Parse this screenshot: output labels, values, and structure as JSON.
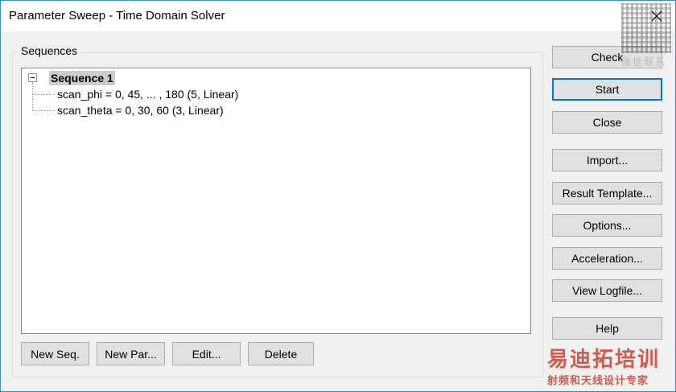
{
  "window": {
    "title": "Parameter Sweep - Time Domain Solver"
  },
  "group": {
    "label": "Sequences"
  },
  "tree": {
    "root": "Sequence 1",
    "items": [
      "scan_phi = 0, 45, ... , 180 (5, Linear)",
      "scan_theta = 0, 30, 60 (3, Linear)"
    ]
  },
  "side_buttons": {
    "check": "Check",
    "start": "Start",
    "close": "Close",
    "import": "Import...",
    "result_template": "Result Template...",
    "options": "Options...",
    "acceleration": "Acceleration...",
    "view_logfile": "View Logfile...",
    "help": "Help"
  },
  "bottom_buttons": {
    "new_seq": "New Seq.",
    "new_par": "New Par...",
    "edit": "Edit...",
    "delete": "Delete"
  },
  "watermark": {
    "qr_label": "微信联系",
    "brand": "易迪拓培训",
    "tagline": "射频和天线设计专家"
  },
  "colors": {
    "accent": "#0078d7",
    "watermark": "#d04a3c"
  }
}
